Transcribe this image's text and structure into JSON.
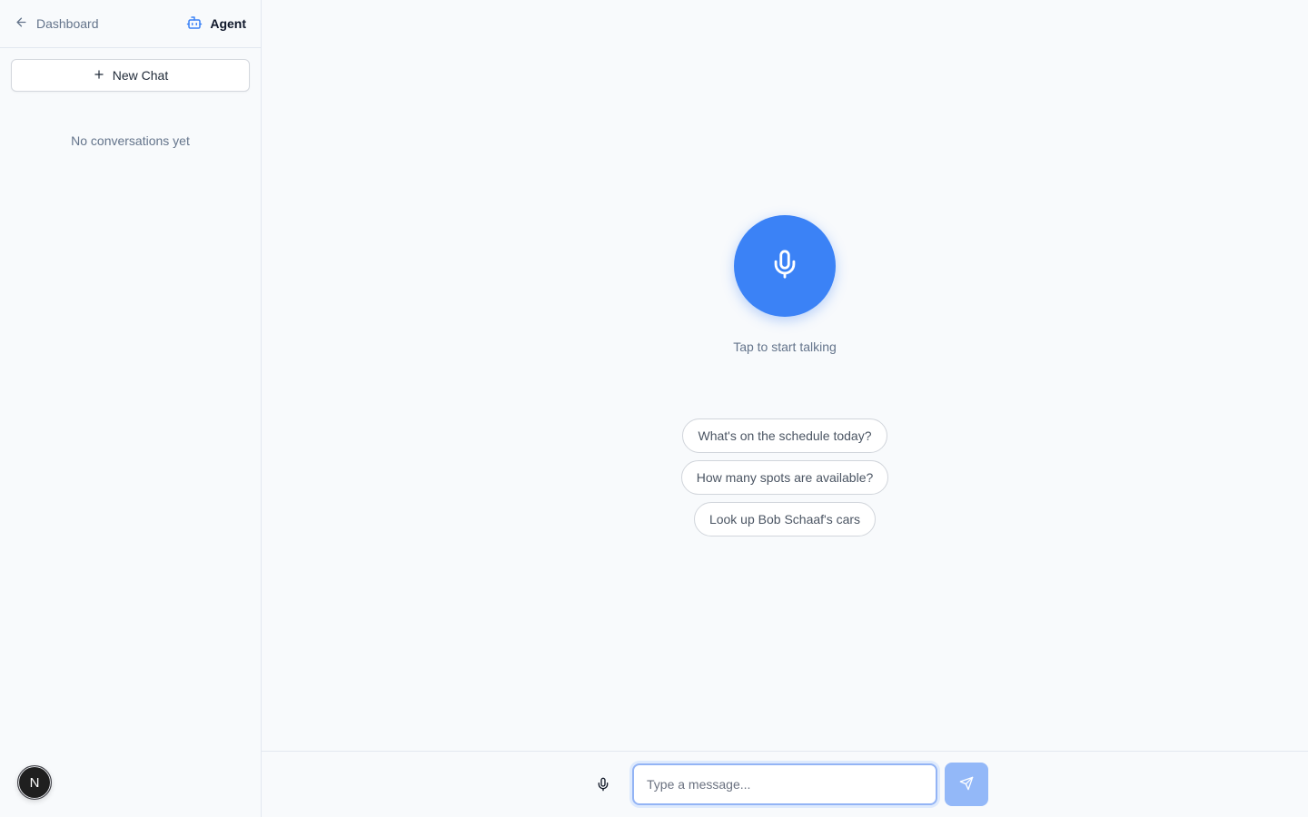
{
  "sidebar": {
    "back_label": "Dashboard",
    "agent_label": "Agent",
    "new_chat_label": "New Chat",
    "empty_text": "No conversations yet",
    "avatar_initial": "N"
  },
  "main": {
    "tap_text": "Tap to start talking",
    "suggestions": [
      "What's on the schedule today?",
      "How many spots are available?",
      "Look up Bob Schaaf's cars"
    ]
  },
  "composer": {
    "placeholder": "Type a message..."
  },
  "colors": {
    "accent": "#3b82f6",
    "send_disabled": "#93b8f8",
    "muted_text": "#64748b"
  },
  "icons": {
    "back": "arrow-left-icon",
    "agent": "bot-icon",
    "new_chat": "plus-icon",
    "mic": "microphone-icon",
    "send": "send-icon"
  }
}
